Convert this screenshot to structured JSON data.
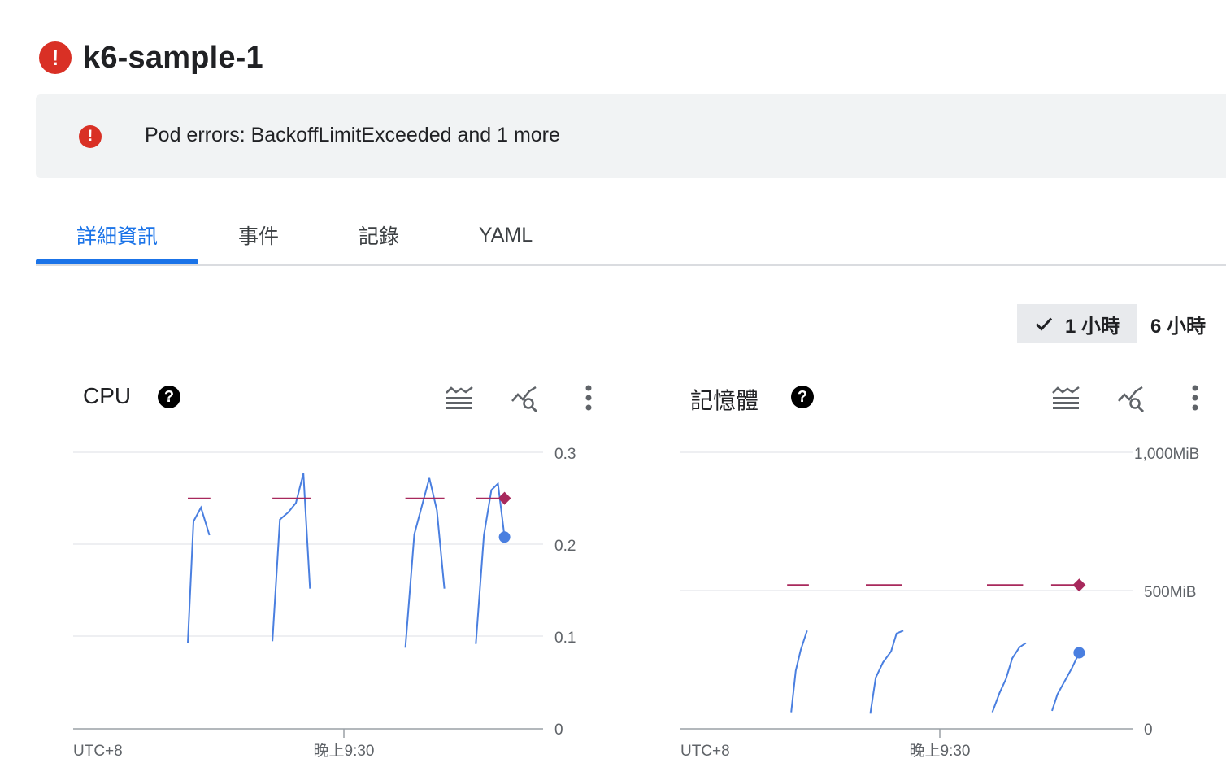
{
  "header": {
    "title": "k6-sample-1",
    "status_icon": "error-icon",
    "status_color": "#d93025"
  },
  "banner": {
    "message": "Pod errors: BackoffLimitExceeded and 1 more",
    "icon": "error-icon"
  },
  "tabs": [
    {
      "label": "詳細資訊",
      "active": true
    },
    {
      "label": "事件",
      "active": false
    },
    {
      "label": "記錄",
      "active": false
    },
    {
      "label": "YAML",
      "active": false
    }
  ],
  "time_range": {
    "options": [
      "1 小時",
      "6 小時"
    ],
    "selected": "1 小時"
  },
  "colors": {
    "accent": "#1a73e8",
    "usage_line": "#4a7fe0",
    "request_line": "#a8295c",
    "error": "#d93025"
  },
  "charts": [
    {
      "title": "CPU",
      "toolbar_icons": [
        "legend-toggle-icon",
        "explore-icon",
        "more-vert-icon"
      ],
      "timezone": "UTC+8",
      "x_tick": "晚上9:30",
      "y_ticks": [
        "0.3",
        "0.2",
        "0.1",
        "0"
      ]
    },
    {
      "title": "記憶體",
      "toolbar_icons": [
        "legend-toggle-icon",
        "explore-icon",
        "more-vert-icon"
      ],
      "timezone": "UTC+8",
      "x_tick": "晚上9:30",
      "y_ticks": [
        "1,000MiB",
        "500MiB",
        "0"
      ]
    }
  ],
  "chart_data": [
    {
      "type": "line",
      "title": "CPU",
      "ylim": [
        0,
        0.3
      ],
      "x_axis": {
        "label": "UTC+8",
        "ticks": [
          "晚上9:30"
        ]
      },
      "series": [
        {
          "kind": "usage",
          "segments": [
            [
              [
                0.244,
                0.093
              ],
              [
                0.256,
                0.225
              ],
              [
                0.272,
                0.24
              ],
              [
                0.29,
                0.21
              ]
            ],
            [
              [
                0.424,
                0.095
              ],
              [
                0.44,
                0.227
              ],
              [
                0.458,
                0.235
              ],
              [
                0.474,
                0.245
              ],
              [
                0.49,
                0.277
              ],
              [
                0.504,
                0.152
              ]
            ],
            [
              [
                0.707,
                0.088
              ],
              [
                0.726,
                0.211
              ],
              [
                0.758,
                0.272
              ],
              [
                0.774,
                0.237
              ],
              [
                0.79,
                0.152
              ]
            ],
            [
              [
                0.857,
                0.092
              ],
              [
                0.874,
                0.21
              ],
              [
                0.89,
                0.259
              ],
              [
                0.904,
                0.266
              ],
              [
                0.918,
                0.208
              ]
            ]
          ],
          "last_point": [
            0.918,
            0.208
          ]
        },
        {
          "kind": "request",
          "segments": [
            [
              [
                0.244,
                0.25
              ],
              [
                0.292,
                0.25
              ]
            ],
            [
              [
                0.424,
                0.25
              ],
              [
                0.506,
                0.25
              ]
            ],
            [
              [
                0.707,
                0.25
              ],
              [
                0.79,
                0.25
              ]
            ],
            [
              [
                0.857,
                0.25
              ],
              [
                0.918,
                0.25
              ]
            ]
          ],
          "last_point": [
            0.918,
            0.25
          ]
        }
      ]
    },
    {
      "type": "line",
      "title": "記憶體",
      "ylim": [
        0,
        1000
      ],
      "x_axis": {
        "label": "UTC+8",
        "ticks": [
          "晚上9:30"
        ]
      },
      "series": [
        {
          "kind": "usage",
          "segments": [
            [
              [
                0.245,
                60
              ],
              [
                0.255,
                210
              ],
              [
                0.266,
                285
              ],
              [
                0.28,
                355
              ]
            ],
            [
              [
                0.42,
                55
              ],
              [
                0.432,
                185
              ],
              [
                0.448,
                240
              ],
              [
                0.466,
                280
              ],
              [
                0.478,
                345
              ],
              [
                0.493,
                355
              ]
            ],
            [
              [
                0.69,
                60
              ],
              [
                0.706,
                130
              ],
              [
                0.72,
                180
              ],
              [
                0.734,
                255
              ],
              [
                0.75,
                295
              ],
              [
                0.764,
                310
              ]
            ],
            [
              [
                0.822,
                65
              ],
              [
                0.834,
                125
              ],
              [
                0.866,
                220
              ],
              [
                0.882,
                275
              ]
            ]
          ],
          "last_point": [
            0.882,
            275
          ]
        },
        {
          "kind": "request",
          "segments": [
            [
              [
                0.236,
                520
              ],
              [
                0.284,
                520
              ]
            ],
            [
              [
                0.41,
                520
              ],
              [
                0.49,
                520
              ]
            ],
            [
              [
                0.678,
                520
              ],
              [
                0.758,
                520
              ]
            ],
            [
              [
                0.82,
                520
              ],
              [
                0.882,
                520
              ]
            ]
          ],
          "last_point": [
            0.882,
            520
          ]
        }
      ]
    }
  ]
}
